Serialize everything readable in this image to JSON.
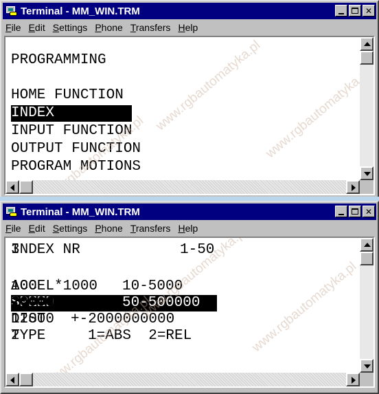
{
  "windows": [
    {
      "title": "Terminal - MM_WIN.TRM",
      "menu": [
        {
          "pre": "",
          "key": "F",
          "post": "ile"
        },
        {
          "pre": "",
          "key": "E",
          "post": "dit"
        },
        {
          "pre": "",
          "key": "S",
          "post": "ettings"
        },
        {
          "pre": "",
          "key": "P",
          "post": "hone"
        },
        {
          "pre": "",
          "key": "T",
          "post": "ransfers"
        },
        {
          "pre": "",
          "key": "H",
          "post": "elp"
        }
      ],
      "lines": [
        {
          "text": "PROGRAMMING",
          "highlight": false
        },
        {
          "text": "",
          "highlight": false
        },
        {
          "text": "HOME FUNCTION",
          "highlight": false
        },
        {
          "text": "INDEX         ",
          "highlight": true
        },
        {
          "text": "INPUT FUNCTION",
          "highlight": false
        },
        {
          "text": "OUTPUT FUNCTION",
          "highlight": false
        },
        {
          "text": "PROGRAM MOTIONS",
          "highlight": false
        }
      ]
    },
    {
      "title": "Terminal - MM_WIN.TRM",
      "menu": [
        {
          "pre": "",
          "key": "F",
          "post": "ile"
        },
        {
          "pre": "",
          "key": "E",
          "post": "dit"
        },
        {
          "pre": "",
          "key": "S",
          "post": "ettings"
        },
        {
          "pre": "",
          "key": "P",
          "post": "hone"
        },
        {
          "pre": "",
          "key": "T",
          "post": "ransfers"
        },
        {
          "pre": "",
          "key": "H",
          "post": "elp"
        }
      ],
      "rows": [
        {
          "label": "INDEX NR",
          "range": "1-50",
          "value": "3",
          "highlight": false,
          "bold": false
        },
        {
          "label": "",
          "range": "",
          "value": "",
          "highlight": false,
          "bold": false
        },
        {
          "label": "ACCEL*1000",
          "range": "10-5000",
          "value": "100",
          "highlight": false,
          "bold": false
        },
        {
          "label": "SPEED",
          "range": "50-500000",
          "value": "20000",
          "highlight": true,
          "bold": true
        },
        {
          "label": "DIST",
          "range": "+-2000000000",
          "value": "12000",
          "highlight": false,
          "bold": false
        },
        {
          "label": "TYPE",
          "range": "1=ABS  2=REL",
          "value": "2",
          "highlight": false,
          "bold": false
        }
      ]
    }
  ],
  "watermark": "www.rgbautomatyka.pl",
  "colors": {
    "titlebar": "#000080",
    "window_face": "#c0c0c0",
    "highlight_bg": "#000000",
    "highlight_fg": "#ffffff",
    "separator": "#b9d6ec"
  }
}
